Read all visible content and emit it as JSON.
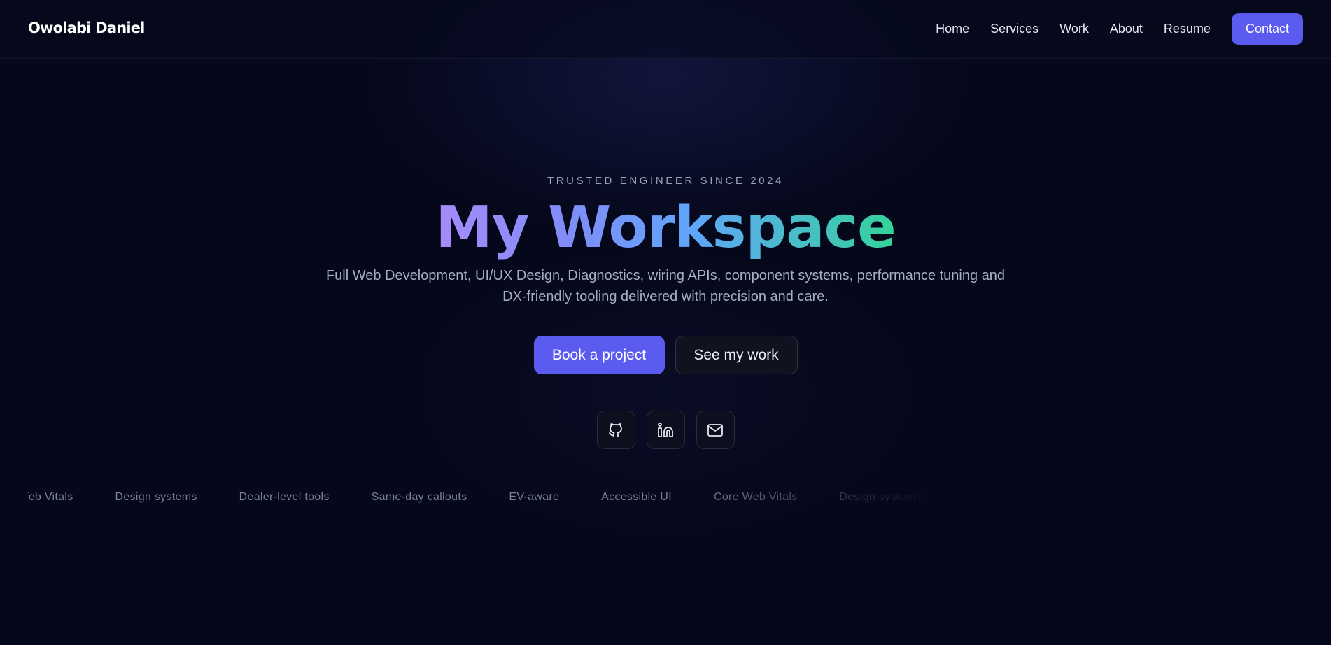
{
  "nav": {
    "brand": "Owolabi Daniel",
    "links": [
      "Home",
      "Services",
      "Work",
      "About",
      "Resume"
    ],
    "contact_label": "Contact"
  },
  "hero": {
    "eyebrow": "TRUSTED ENGINEER SINCE 2024",
    "title": "My Workspace",
    "subtitle": "Full Web Development, UI/UX Design, Diagnostics, wiring APIs, component systems, performance tuning and DX-friendly tooling delivered with precision and care.",
    "primary_cta": "Book a project",
    "secondary_cta": "See my work"
  },
  "social": {
    "icons": [
      "github-icon",
      "linkedin-icon",
      "mail-icon"
    ]
  },
  "marquee": {
    "items": [
      "Core Web Vitals",
      "Design systems",
      "Dealer-level tools",
      "Same-day callouts",
      "EV-aware",
      "Accessible UI",
      "Core Web Vitals",
      "Design systems"
    ]
  },
  "colors": {
    "background": "#05071a",
    "accent": "#5b5bf0",
    "gradient_start": "#a78bfa",
    "gradient_mid": "#60a5fa",
    "gradient_end": "#34d399"
  }
}
